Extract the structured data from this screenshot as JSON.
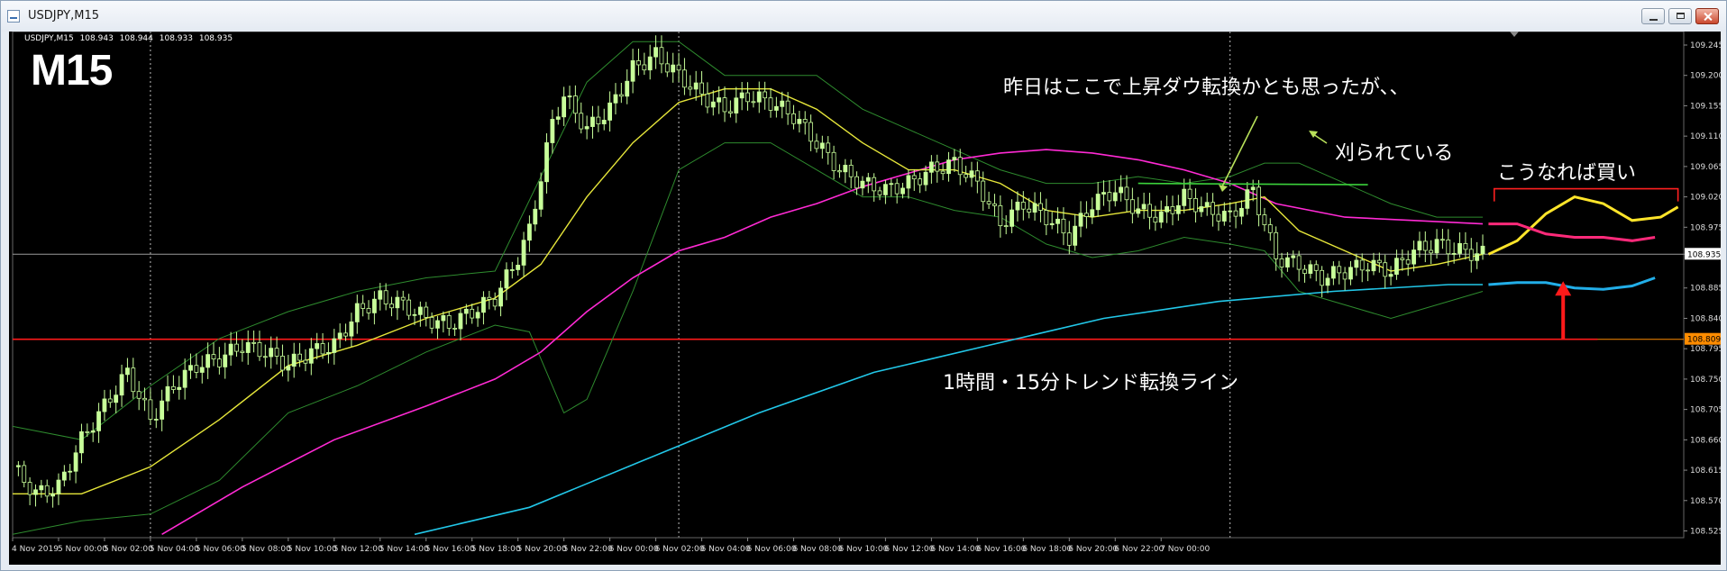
{
  "window": {
    "title": "USDJPY,M15"
  },
  "chart_header": {
    "symbol": "USDJPY,M15",
    "ohlc": [
      "108.943",
      "108.944",
      "108.933",
      "108.935"
    ]
  },
  "timeframe_label": "M15",
  "annotations": {
    "top_comment": "昨日はここで上昇ダウ転換かとも思ったが、、",
    "cut_comment": "刈られている",
    "buy_comment": "こうなれば買い",
    "line_comment": "1時間・15分トレンド転換ライン"
  },
  "colors": {
    "background": "#000000",
    "candle_up": "#c8ff9a",
    "candle_down": "#c8ff9a",
    "sma20": "#e6e63a",
    "bollinger": "#2e8b2e",
    "sma75": "#ff2ad4",
    "sma200": "#22c7e8",
    "support_line": "#ff1a1a",
    "current_price_line": "#9a9a9a"
  },
  "chart_data": {
    "type": "candlestick",
    "symbol": "USDJPY",
    "timeframe": "M15",
    "ylim": [
      108.515,
      109.265
    ],
    "y_ticks": [
      "109.245",
      "109.200",
      "109.155",
      "109.110",
      "109.065",
      "109.020",
      "108.975",
      "108.935",
      "108.885",
      "108.840",
      "108.795",
      "108.750",
      "108.705",
      "108.660",
      "108.615",
      "108.570",
      "108.525"
    ],
    "x_ticks": [
      "4 Nov 2019",
      "5 Nov 00:00",
      "5 Nov 02:00",
      "5 Nov 04:00",
      "5 Nov 06:00",
      "5 Nov 08:00",
      "5 Nov 10:00",
      "5 Nov 12:00",
      "5 Nov 14:00",
      "5 Nov 16:00",
      "5 Nov 18:00",
      "5 Nov 20:00",
      "5 Nov 22:00",
      "6 Nov 00:00",
      "6 Nov 02:00",
      "6 Nov 04:00",
      "6 Nov 06:00",
      "6 Nov 08:00",
      "6 Nov 10:00",
      "6 Nov 12:00",
      "6 Nov 14:00",
      "6 Nov 16:00",
      "6 Nov 18:00",
      "6 Nov 20:00",
      "6 Nov 22:00",
      "7 Nov 00:00"
    ],
    "current_price": "108.935",
    "level_line_price": "108.809",
    "close_path": [
      [
        0,
        108.62
      ],
      [
        4,
        108.58
      ],
      [
        8,
        108.59
      ],
      [
        12,
        108.66
      ],
      [
        16,
        108.71
      ],
      [
        20,
        108.76
      ],
      [
        24,
        108.69
      ],
      [
        28,
        108.74
      ],
      [
        32,
        108.77
      ],
      [
        36,
        108.78
      ],
      [
        40,
        108.8
      ],
      [
        44,
        108.79
      ],
      [
        48,
        108.77
      ],
      [
        52,
        108.79
      ],
      [
        56,
        108.8
      ],
      [
        60,
        108.85
      ],
      [
        64,
        108.87
      ],
      [
        68,
        108.86
      ],
      [
        72,
        108.84
      ],
      [
        76,
        108.83
      ],
      [
        80,
        108.85
      ],
      [
        84,
        108.87
      ],
      [
        88,
        108.93
      ],
      [
        90,
        108.97
      ],
      [
        92,
        109.05
      ],
      [
        94,
        109.13
      ],
      [
        96,
        109.17
      ],
      [
        100,
        109.12
      ],
      [
        104,
        109.15
      ],
      [
        108,
        109.21
      ],
      [
        112,
        109.23
      ],
      [
        116,
        109.2
      ],
      [
        120,
        109.17
      ],
      [
        124,
        109.15
      ],
      [
        128,
        109.17
      ],
      [
        132,
        109.16
      ],
      [
        136,
        109.14
      ],
      [
        140,
        109.1
      ],
      [
        144,
        109.06
      ],
      [
        148,
        109.04
      ],
      [
        152,
        109.03
      ],
      [
        156,
        109.04
      ],
      [
        160,
        109.06
      ],
      [
        164,
        109.07
      ],
      [
        168,
        109.04
      ],
      [
        172,
        108.98
      ],
      [
        176,
        109.01
      ],
      [
        180,
        108.99
      ],
      [
        184,
        108.96
      ],
      [
        188,
        109.01
      ],
      [
        192,
        109.03
      ],
      [
        196,
        109.0
      ],
      [
        200,
        108.99
      ],
      [
        204,
        109.02
      ],
      [
        208,
        109.0
      ],
      [
        212,
        108.99
      ],
      [
        216,
        109.03
      ],
      [
        220,
        108.93
      ],
      [
        224,
        108.92
      ],
      [
        228,
        108.9
      ],
      [
        232,
        108.91
      ],
      [
        236,
        108.92
      ],
      [
        240,
        108.91
      ],
      [
        244,
        108.94
      ],
      [
        248,
        108.95
      ],
      [
        252,
        108.94
      ],
      [
        256,
        108.935
      ]
    ],
    "sma20_path": [
      [
        0,
        108.58
      ],
      [
        12,
        108.58
      ],
      [
        24,
        108.62
      ],
      [
        36,
        108.69
      ],
      [
        48,
        108.77
      ],
      [
        60,
        108.8
      ],
      [
        72,
        108.84
      ],
      [
        84,
        108.87
      ],
      [
        92,
        108.92
      ],
      [
        100,
        109.02
      ],
      [
        108,
        109.1
      ],
      [
        116,
        109.16
      ],
      [
        124,
        109.18
      ],
      [
        132,
        109.18
      ],
      [
        140,
        109.15
      ],
      [
        148,
        109.1
      ],
      [
        156,
        109.06
      ],
      [
        164,
        109.06
      ],
      [
        172,
        109.04
      ],
      [
        180,
        109.0
      ],
      [
        188,
        108.99
      ],
      [
        196,
        109.0
      ],
      [
        204,
        109.0
      ],
      [
        212,
        109.01
      ],
      [
        218,
        109.02
      ],
      [
        224,
        108.97
      ],
      [
        232,
        108.94
      ],
      [
        240,
        108.91
      ],
      [
        248,
        108.92
      ],
      [
        256,
        108.935
      ]
    ],
    "bb_upper_path": [
      [
        0,
        108.68
      ],
      [
        12,
        108.66
      ],
      [
        24,
        108.74
      ],
      [
        36,
        108.81
      ],
      [
        48,
        108.85
      ],
      [
        60,
        108.88
      ],
      [
        72,
        108.9
      ],
      [
        84,
        108.91
      ],
      [
        92,
        109.05
      ],
      [
        100,
        109.19
      ],
      [
        108,
        109.25
      ],
      [
        116,
        109.25
      ],
      [
        124,
        109.2
      ],
      [
        132,
        109.2
      ],
      [
        140,
        109.2
      ],
      [
        148,
        109.15
      ],
      [
        156,
        109.12
      ],
      [
        164,
        109.09
      ],
      [
        172,
        109.06
      ],
      [
        180,
        109.04
      ],
      [
        188,
        109.04
      ],
      [
        196,
        109.05
      ],
      [
        204,
        109.04
      ],
      [
        212,
        109.05
      ],
      [
        218,
        109.07
      ],
      [
        224,
        109.07
      ],
      [
        232,
        109.04
      ],
      [
        240,
        109.01
      ],
      [
        248,
        108.99
      ],
      [
        256,
        108.99
      ]
    ],
    "bb_lower_path": [
      [
        0,
        108.52
      ],
      [
        12,
        108.54
      ],
      [
        24,
        108.55
      ],
      [
        36,
        108.6
      ],
      [
        48,
        108.7
      ],
      [
        60,
        108.74
      ],
      [
        72,
        108.79
      ],
      [
        84,
        108.83
      ],
      [
        90,
        108.82
      ],
      [
        96,
        108.7
      ],
      [
        100,
        108.72
      ],
      [
        108,
        108.88
      ],
      [
        116,
        109.06
      ],
      [
        124,
        109.1
      ],
      [
        132,
        109.1
      ],
      [
        140,
        109.06
      ],
      [
        148,
        109.02
      ],
      [
        156,
        109.02
      ],
      [
        164,
        109.0
      ],
      [
        172,
        108.99
      ],
      [
        180,
        108.95
      ],
      [
        188,
        108.93
      ],
      [
        196,
        108.94
      ],
      [
        204,
        108.96
      ],
      [
        212,
        108.95
      ],
      [
        218,
        108.94
      ],
      [
        224,
        108.88
      ],
      [
        232,
        108.86
      ],
      [
        240,
        108.84
      ],
      [
        248,
        108.86
      ],
      [
        256,
        108.88
      ]
    ],
    "sma75_path": [
      [
        26,
        108.52
      ],
      [
        40,
        108.59
      ],
      [
        56,
        108.66
      ],
      [
        72,
        108.71
      ],
      [
        84,
        108.75
      ],
      [
        92,
        108.79
      ],
      [
        100,
        108.85
      ],
      [
        108,
        108.9
      ],
      [
        116,
        108.94
      ],
      [
        124,
        108.96
      ],
      [
        132,
        108.99
      ],
      [
        140,
        109.01
      ],
      [
        148,
        109.035
      ],
      [
        156,
        109.055
      ],
      [
        164,
        109.075
      ],
      [
        172,
        109.085
      ],
      [
        180,
        109.09
      ],
      [
        188,
        109.085
      ],
      [
        196,
        109.075
      ],
      [
        204,
        109.06
      ],
      [
        212,
        109.04
      ],
      [
        220,
        109.01
      ],
      [
        232,
        108.99
      ],
      [
        244,
        108.985
      ],
      [
        256,
        108.98
      ]
    ],
    "sma200_path": [
      [
        70,
        108.52
      ],
      [
        90,
        108.56
      ],
      [
        110,
        108.63
      ],
      [
        130,
        108.7
      ],
      [
        150,
        108.76
      ],
      [
        170,
        108.8
      ],
      [
        190,
        108.84
      ],
      [
        210,
        108.865
      ],
      [
        230,
        108.88
      ],
      [
        250,
        108.89
      ],
      [
        256,
        108.89
      ]
    ],
    "support_line_path": [
      [
        0,
        108.809
      ],
      [
        276,
        108.809
      ]
    ],
    "forecast_yellow": [
      [
        257,
        108.935
      ],
      [
        262,
        108.955
      ],
      [
        267,
        108.995
      ],
      [
        272,
        109.02
      ],
      [
        277,
        109.01
      ],
      [
        282,
        108.985
      ],
      [
        287,
        108.99
      ],
      [
        290,
        109.005
      ]
    ],
    "forecast_pink": [
      [
        257,
        108.98
      ],
      [
        262,
        108.98
      ],
      [
        267,
        108.965
      ],
      [
        272,
        108.96
      ],
      [
        277,
        108.96
      ],
      [
        282,
        108.955
      ],
      [
        286,
        108.96
      ]
    ],
    "forecast_blue": [
      [
        257,
        108.89
      ],
      [
        262,
        108.893
      ],
      [
        267,
        108.893
      ],
      [
        272,
        108.885
      ],
      [
        277,
        108.883
      ],
      [
        282,
        108.888
      ],
      [
        286,
        108.9
      ]
    ],
    "trendline": [
      [
        196,
        109.04
      ],
      [
        236,
        109.038
      ]
    ]
  }
}
